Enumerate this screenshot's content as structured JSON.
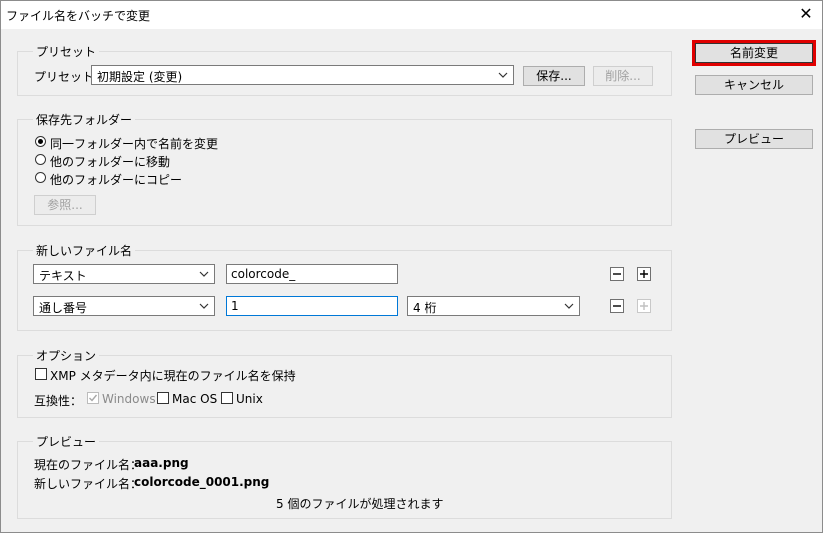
{
  "window": {
    "title": "ファイル名をバッチで変更",
    "close_glyph": "✕"
  },
  "side_buttons": {
    "rename": "名前変更",
    "cancel": "キャンセル",
    "preview": "プレビュー"
  },
  "preset": {
    "group_label": "プリセット",
    "label": "プリセット：",
    "selected": "初期設定 (変更)",
    "save": "保存...",
    "delete": "削除..."
  },
  "destination": {
    "group_label": "保存先フォルダー",
    "options": [
      "同一フォルダー内で名前を変更",
      "他のフォルダーに移動",
      "他のフォルダーにコピー"
    ],
    "selected_index": 0,
    "browse": "参照..."
  },
  "new_name": {
    "group_label": "新しいファイル名",
    "row1": {
      "type": "テキスト",
      "value": "colorcode_"
    },
    "row2": {
      "type": "通し番号",
      "value": "1",
      "digits": "4 桁"
    }
  },
  "options": {
    "group_label": "オプション",
    "keep_xmp": "XMP メタデータ内に現在のファイル名を保持",
    "compat_label": "互換性：",
    "windows": "Windows",
    "macos": "Mac OS",
    "unix": "Unix"
  },
  "preview": {
    "group_label": "プレビュー",
    "current_label": "現在のファイル名：",
    "current_value": "aaa.png",
    "new_label": "新しいファイル名：",
    "new_value": "colorcode_0001.png",
    "status": "5 個のファイルが処理されます"
  },
  "colors": {
    "highlight": "#e00000",
    "focus_border": "#0078d7"
  }
}
